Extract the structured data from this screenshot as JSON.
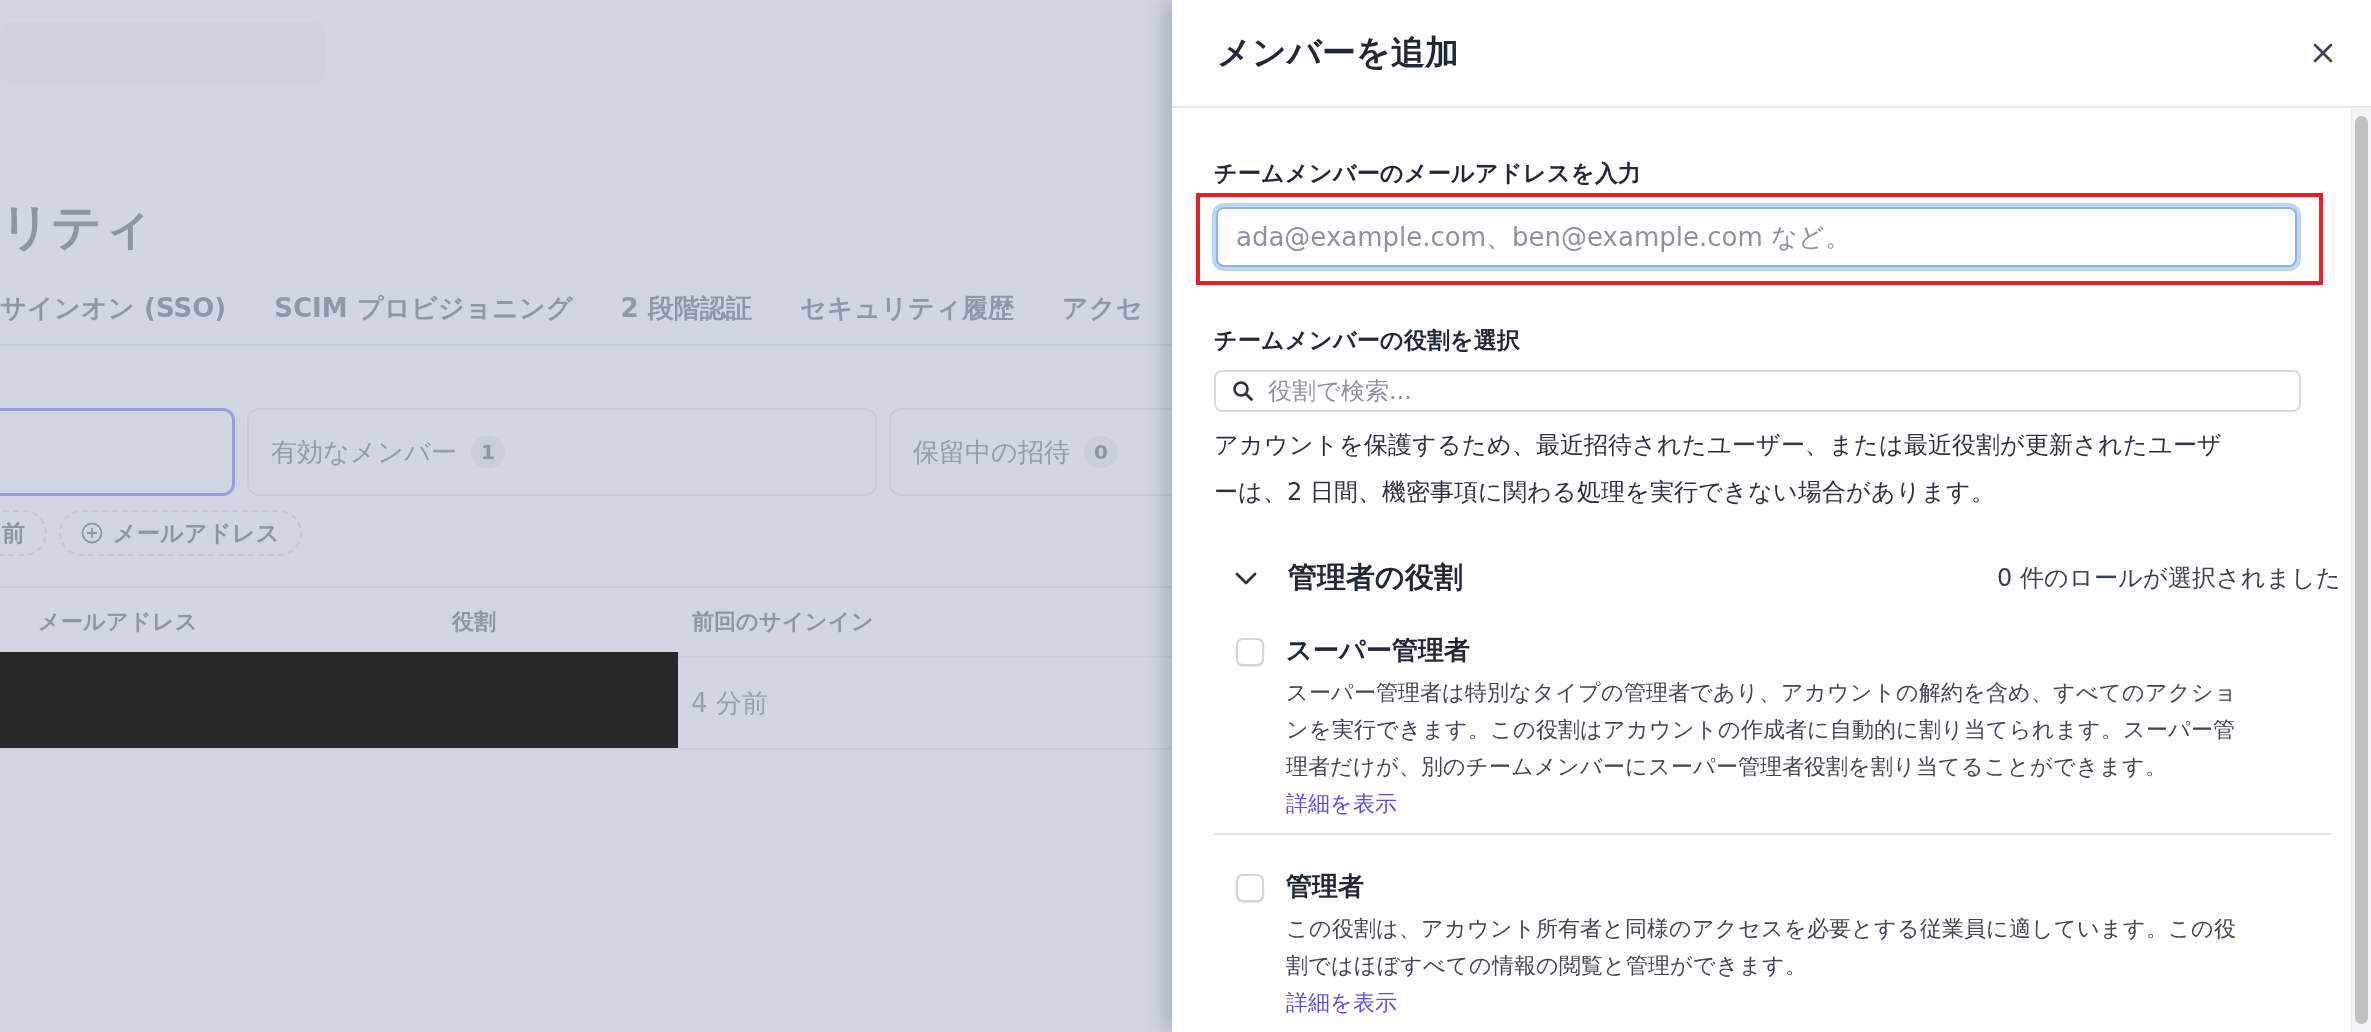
{
  "background": {
    "page_title": "リティ",
    "tabs": [
      {
        "label": "サインオン (SSO)"
      },
      {
        "label": "SCIM プロビジョニング"
      },
      {
        "label": "2 段階認証"
      },
      {
        "label": "セキュリティ履歴"
      },
      {
        "label": "アクセ"
      }
    ],
    "filter_cards": [
      {
        "selected": true
      },
      {
        "label": "有効なメンバー",
        "count": "1",
        "selected": false
      },
      {
        "label": "保留中の招待",
        "count": "0",
        "selected": false
      }
    ],
    "filter_chips": [
      {
        "label": "前",
        "plus": false
      },
      {
        "label": "メールアドレス",
        "plus": true
      }
    ],
    "table": {
      "columns": [
        "メールアドレス",
        "役割",
        "前回のサインイン"
      ],
      "rows": [
        {
          "last_sign_in": "4 分前"
        }
      ]
    }
  },
  "panel": {
    "title": "メンバーを追加",
    "email_field": {
      "label": "チームメンバーのメールアドレスを入力",
      "placeholder": "ada@example.com、ben@example.com など。",
      "highlighted": true
    },
    "role_search": {
      "label": "チームメンバーの役割を選択",
      "placeholder": "役割で検索..."
    },
    "notice": "アカウントを保護するため、最近招待されたユーザー、または最近役割が更新されたユーザーは、2 日間、機密事項に関わる処理を実行できない場合があります。",
    "role_group": {
      "title": "管理者の役割",
      "expanded": true,
      "selected_count": "0 件のロールが選択されました",
      "roles": [
        {
          "name": "スーパー管理者",
          "checked": false,
          "description": "スーパー管理者は特別なタイプの管理者であり、アカウントの解約を含め、すべてのアクションを実行できます。この役割はアカウントの作成者に自動的に割り当てられます。スーパー管理者だけが、別のチームメンバーにスーパー管理者役割を割り当てることができます。",
          "link": "詳細を表示"
        },
        {
          "name": "管理者",
          "checked": false,
          "description": "この役割は、アカウント所有者と同様のアクセスを必要とする従業員に適しています。この役割ではほぼすべての情報の閲覧と管理ができます。",
          "link": "詳細を表示"
        }
      ]
    }
  }
}
